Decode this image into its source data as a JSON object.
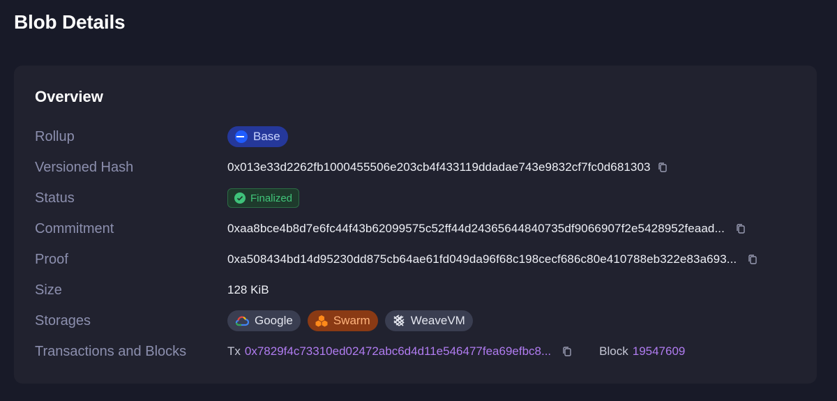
{
  "page": {
    "title": "Blob Details"
  },
  "overview": {
    "title": "Overview",
    "rollup": {
      "label": "Rollup",
      "value": "Base"
    },
    "versioned_hash": {
      "label": "Versioned Hash",
      "value": "0x013e33d2262fb1000455506e203cb4f433119ddadae743e9832cf7fc0d681303"
    },
    "status": {
      "label": "Status",
      "value": "Finalized"
    },
    "commitment": {
      "label": "Commitment",
      "value": "0xaa8bce4b8d7e6fc44f43b62099575c52ff44d24365644840735df9066907f2e5428952feaad..."
    },
    "proof": {
      "label": "Proof",
      "value": "0xa508434bd14d95230dd875cb64ae61fd049da96f68c198cecf686c80e410788eb322e83a693..."
    },
    "size": {
      "label": "Size",
      "value": "128 KiB"
    },
    "storages": {
      "label": "Storages",
      "items": [
        {
          "name": "Google",
          "icon": "google-cloud-icon"
        },
        {
          "name": "Swarm",
          "icon": "swarm-icon"
        },
        {
          "name": "WeaveVM",
          "icon": "weavevm-icon"
        }
      ]
    },
    "transactions": {
      "label": "Transactions and Blocks",
      "tx_prefix": "Tx",
      "tx_hash": "0x7829f4c73310ed02472abc6d4d11e546477fea69efbc8...",
      "block_prefix": "Block",
      "block_number": "19547609"
    }
  },
  "colors": {
    "background": "#181a28",
    "card": "#21222f",
    "label": "#8c8fae",
    "link": "#b07cf0",
    "finalized": "#41c57a",
    "base_pill": "#25389a"
  }
}
